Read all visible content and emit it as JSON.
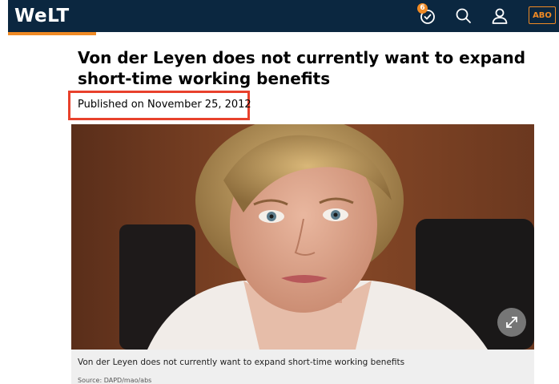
{
  "header": {
    "logo": "WeLT",
    "badge_count": "6",
    "abo_label": "ABO",
    "icons": [
      "history-icon",
      "search-icon",
      "user-icon"
    ]
  },
  "article": {
    "headline": "Von der Leyen does not currently want to expand short-time working benefits",
    "published": "Published on November 25, 2012",
    "caption": "Von der Leyen does not currently want to expand short-time working benefits",
    "source": "Source: DAPD/mao/abs"
  },
  "colors": {
    "header_bg": "#0b2740",
    "accent": "#f08a24",
    "highlight_box": "#e8412c",
    "caption_bg": "#efefef"
  }
}
